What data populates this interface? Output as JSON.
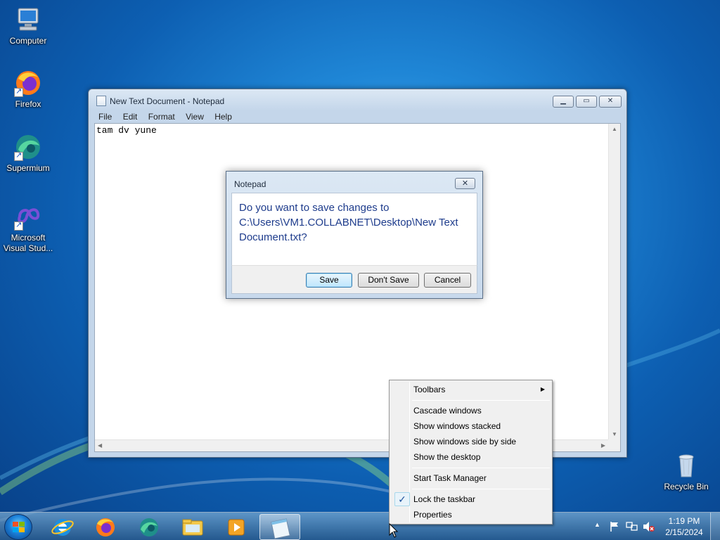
{
  "desktop": {
    "icons": [
      {
        "label": "Computer",
        "icon": "computer-icon"
      },
      {
        "label": "Firefox",
        "icon": "firefox-icon"
      },
      {
        "label": "Supermium",
        "icon": "supermium-icon"
      },
      {
        "label": "Microsoft Visual Stud...",
        "icon": "visual-studio-icon"
      },
      {
        "label": "Recycle Bin",
        "icon": "recycle-bin-icon"
      }
    ]
  },
  "notepad": {
    "title": "New Text Document - Notepad",
    "menu": [
      "File",
      "Edit",
      "Format",
      "View",
      "Help"
    ],
    "content": "tam dv yune",
    "controls": {
      "minimize": "minimize-icon",
      "maximize": "maximize-icon",
      "close": "close-icon"
    }
  },
  "dialog": {
    "title": "Notepad",
    "message": "Do you want to save changes to C:\\Users\\VM1.COLLABNET\\Desktop\\New Text Document.txt?",
    "buttons": {
      "save": "Save",
      "dont_save": "Don't Save",
      "cancel": "Cancel"
    }
  },
  "context_menu": {
    "items": [
      {
        "label": "Toolbars",
        "submenu": true
      },
      {
        "label": "Cascade windows"
      },
      {
        "label": "Show windows stacked"
      },
      {
        "label": "Show windows side by side"
      },
      {
        "label": "Show the desktop"
      },
      {
        "label": "Start Task Manager"
      },
      {
        "label": "Lock the taskbar",
        "checked": true
      },
      {
        "label": "Properties"
      }
    ]
  },
  "taskbar": {
    "pinned": [
      "internet-explorer-icon",
      "firefox-icon",
      "supermium-icon",
      "file-explorer-icon",
      "media-player-icon",
      "notepad-icon"
    ],
    "active": "notepad-icon",
    "tray_icons": [
      "show-hidden-icons-arrow",
      "action-center-flag-icon",
      "network-icon",
      "volume-muted-icon"
    ],
    "clock": {
      "time": "1:19 PM",
      "date": "2/15/2024"
    }
  },
  "colors": {
    "dialog_text": "#1e3c8c",
    "desktop_blue": "#1f86d6"
  }
}
